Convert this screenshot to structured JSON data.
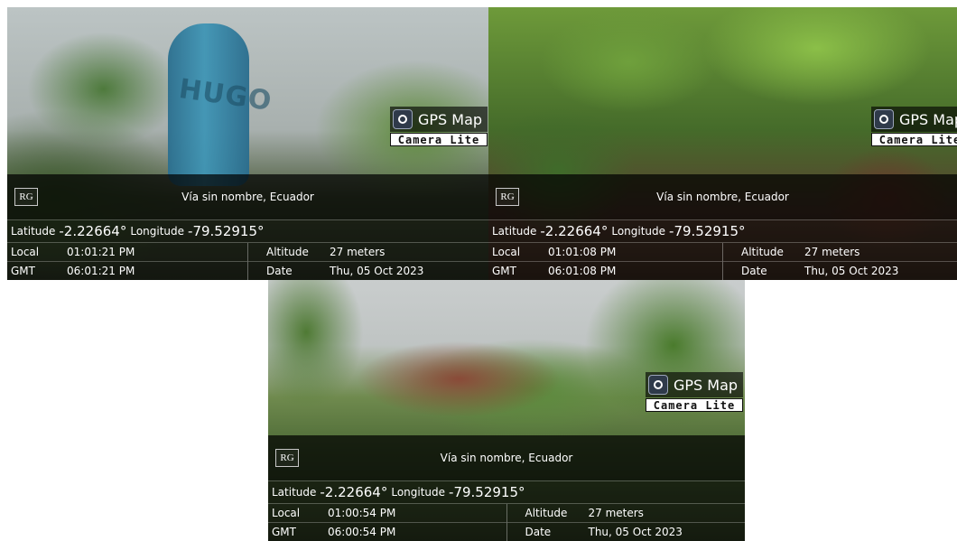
{
  "photos": [
    {
      "bag_text": "HUGO",
      "badge": {
        "icon": "camera-lens-icon",
        "title": "GPS Map",
        "subtitle": "Camera Lite"
      },
      "logo": "RG",
      "address": "Vía sin nombre, Ecuador",
      "latitude_label": "Latitude",
      "latitude": "-2.22664°",
      "longitude_label": "Longitude",
      "longitude": "-79.52915°",
      "local_label": "Local",
      "local_time": "01:01:21 PM",
      "gmt_label": "GMT",
      "gmt_time": "06:01:21 PM",
      "altitude_label": "Altitude",
      "altitude": "27 meters",
      "date_label": "Date",
      "date": "Thu, 05 Oct 2023"
    },
    {
      "badge": {
        "icon": "camera-lens-icon",
        "title": "GPS Map",
        "subtitle": "Camera Lite"
      },
      "logo": "RG",
      "address": "Vía sin nombre, Ecuador",
      "latitude_label": "Latitude",
      "latitude": "-2.22664°",
      "longitude_label": "Longitude",
      "longitude": "-79.52915°",
      "local_label": "Local",
      "local_time": "01:01:08 PM",
      "gmt_label": "GMT",
      "gmt_time": "06:01:08 PM",
      "altitude_label": "Altitude",
      "altitude": "27 meters",
      "date_label": "Date",
      "date": "Thu, 05 Oct 2023"
    },
    {
      "badge": {
        "icon": "camera-lens-icon",
        "title": "GPS Map",
        "subtitle": "Camera Lite"
      },
      "logo": "RG",
      "address": "Vía sin nombre, Ecuador",
      "latitude_label": "Latitude",
      "latitude": "-2.22664°",
      "longitude_label": "Longitude",
      "longitude": "-79.52915°",
      "local_label": "Local",
      "local_time": "01:00:54 PM",
      "gmt_label": "GMT",
      "gmt_time": "06:00:54 PM",
      "altitude_label": "Altitude",
      "altitude": "27 meters",
      "date_label": "Date",
      "date": "Thu, 05 Oct 2023"
    }
  ]
}
